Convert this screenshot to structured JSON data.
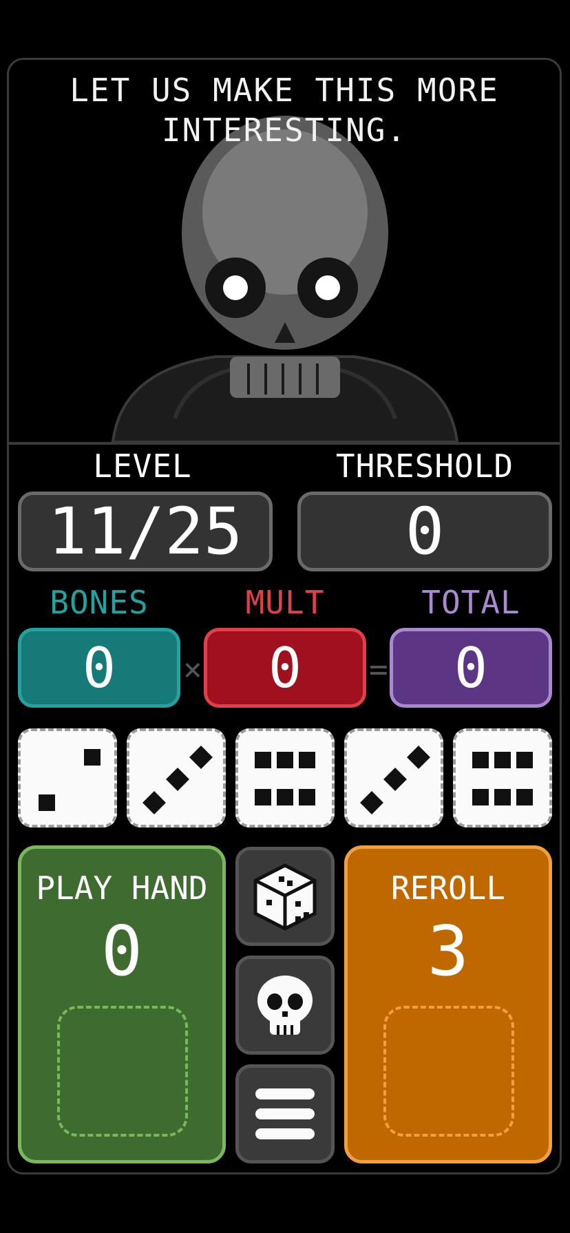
{
  "dialog": {
    "line1": "LET US MAKE THIS MORE",
    "line2": "INTERESTING."
  },
  "portrait": {
    "character_icon": "skull-character"
  },
  "level": {
    "label": "LEVEL",
    "value": "11/25"
  },
  "threshold": {
    "label": "THRESHOLD",
    "value": "0"
  },
  "bones": {
    "label": "BONES",
    "value": "0",
    "color": "#22a3a0"
  },
  "mult": {
    "label": "MULT",
    "value": "0",
    "color": "#c41a2a",
    "operator": "×"
  },
  "total": {
    "label": "TOTAL",
    "value": "0",
    "color": "#6b3d8e",
    "operator": "="
  },
  "dice": [
    {
      "face": 2
    },
    {
      "face": 3
    },
    {
      "face": 6
    },
    {
      "face": 3
    },
    {
      "face": 6
    }
  ],
  "play_hand": {
    "label": "PLAY HAND",
    "count": "0",
    "color": "#3e6b30",
    "accent": "#7ab85c"
  },
  "reroll": {
    "label": "REROLL",
    "count": "3",
    "color": "#c06800",
    "accent": "#f0a040"
  },
  "side_buttons": {
    "dice_icon": "dice-icon",
    "skull_icon": "skull-icon",
    "menu_icon": "menu-icon"
  }
}
